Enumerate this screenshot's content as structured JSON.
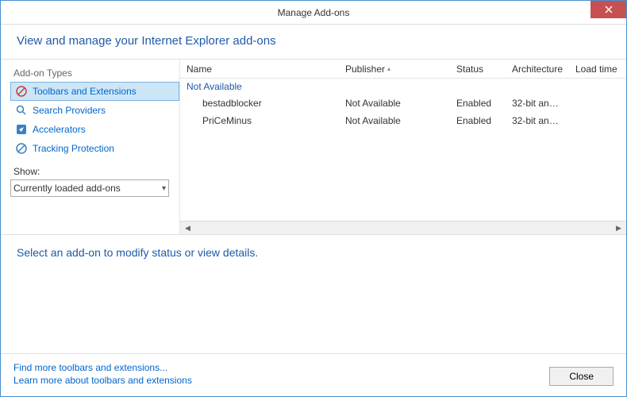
{
  "window": {
    "title": "Manage Add-ons"
  },
  "header": {
    "text": "View and manage your Internet Explorer add-ons"
  },
  "sidebar": {
    "types_label": "Add-on Types",
    "items": [
      {
        "label": "Toolbars and Extensions",
        "icon": "toolbar",
        "selected": true
      },
      {
        "label": "Search Providers",
        "icon": "search",
        "selected": false
      },
      {
        "label": "Accelerators",
        "icon": "accelerator",
        "selected": false
      },
      {
        "label": "Tracking Protection",
        "icon": "block",
        "selected": false
      }
    ],
    "show_label": "Show:",
    "show_value": "Currently loaded add-ons"
  },
  "grid": {
    "columns": {
      "name": "Name",
      "publisher": "Publisher",
      "status": "Status",
      "architecture": "Architecture",
      "load_time": "Load time"
    },
    "group": "Not Available",
    "rows": [
      {
        "name": "bestadblocker",
        "publisher": "Not Available",
        "status": "Enabled",
        "architecture": "32-bit and ..."
      },
      {
        "name": "PriCeMinus",
        "publisher": "Not Available",
        "status": "Enabled",
        "architecture": "32-bit and ..."
      }
    ]
  },
  "detail": {
    "prompt": "Select an add-on to modify status or view details."
  },
  "footer": {
    "link1": "Find more toolbars and extensions...",
    "link2": "Learn more about toolbars and extensions",
    "close": "Close"
  }
}
